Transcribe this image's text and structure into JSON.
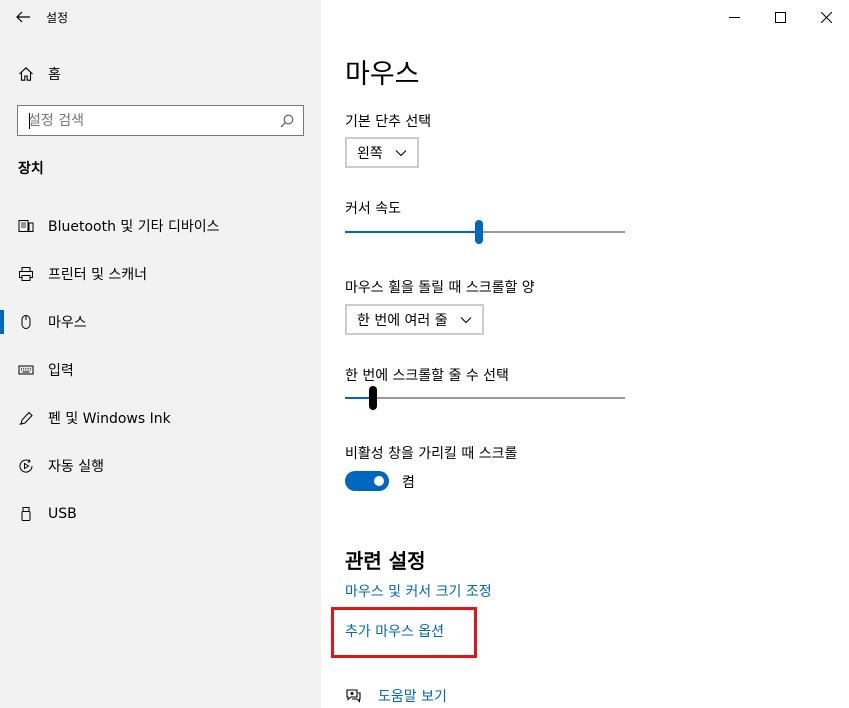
{
  "window": {
    "title": "설정"
  },
  "sidebar": {
    "home_label": "홈",
    "search_placeholder": "설정 검색",
    "section_title": "장치",
    "items": [
      {
        "label": "Bluetooth 및 기타 디바이스",
        "icon": "bluetooth-devices-icon"
      },
      {
        "label": "프린터 및 스캐너",
        "icon": "printer-icon"
      },
      {
        "label": "마우스",
        "icon": "mouse-icon",
        "active": true
      },
      {
        "label": "입력",
        "icon": "keyboard-icon"
      },
      {
        "label": "펜 및 Windows Ink",
        "icon": "pen-icon"
      },
      {
        "label": "자동 실행",
        "icon": "autoplay-icon"
      },
      {
        "label": "USB",
        "icon": "usb-icon"
      }
    ]
  },
  "main": {
    "title": "마우스",
    "primary_button": {
      "label": "기본 단추 선택",
      "value": "왼쪽"
    },
    "cursor_speed": {
      "label": "커서 속도",
      "level": 0.48
    },
    "wheel_scroll": {
      "label": "마우스 휠을 돌릴 때 스크롤할 양",
      "value": "한 번에 여러 줄"
    },
    "lines_per_scroll": {
      "label": "한 번에 스크롤할 줄 수 선택",
      "level": 0.1
    },
    "inactive_scroll": {
      "label": "비활성 창을 가리킬 때 스크롤",
      "state": "켬",
      "on": true
    },
    "related": {
      "title": "관련 설정",
      "links": [
        "마우스 및 커서 크기 조정",
        "추가 마우스 옵션"
      ]
    },
    "help_label": "도움말 보기"
  },
  "colors": {
    "accent": "#0067c0",
    "link": "#0067b8",
    "highlight": "#e0161e",
    "sidebar_bg": "#f2f2f2"
  }
}
